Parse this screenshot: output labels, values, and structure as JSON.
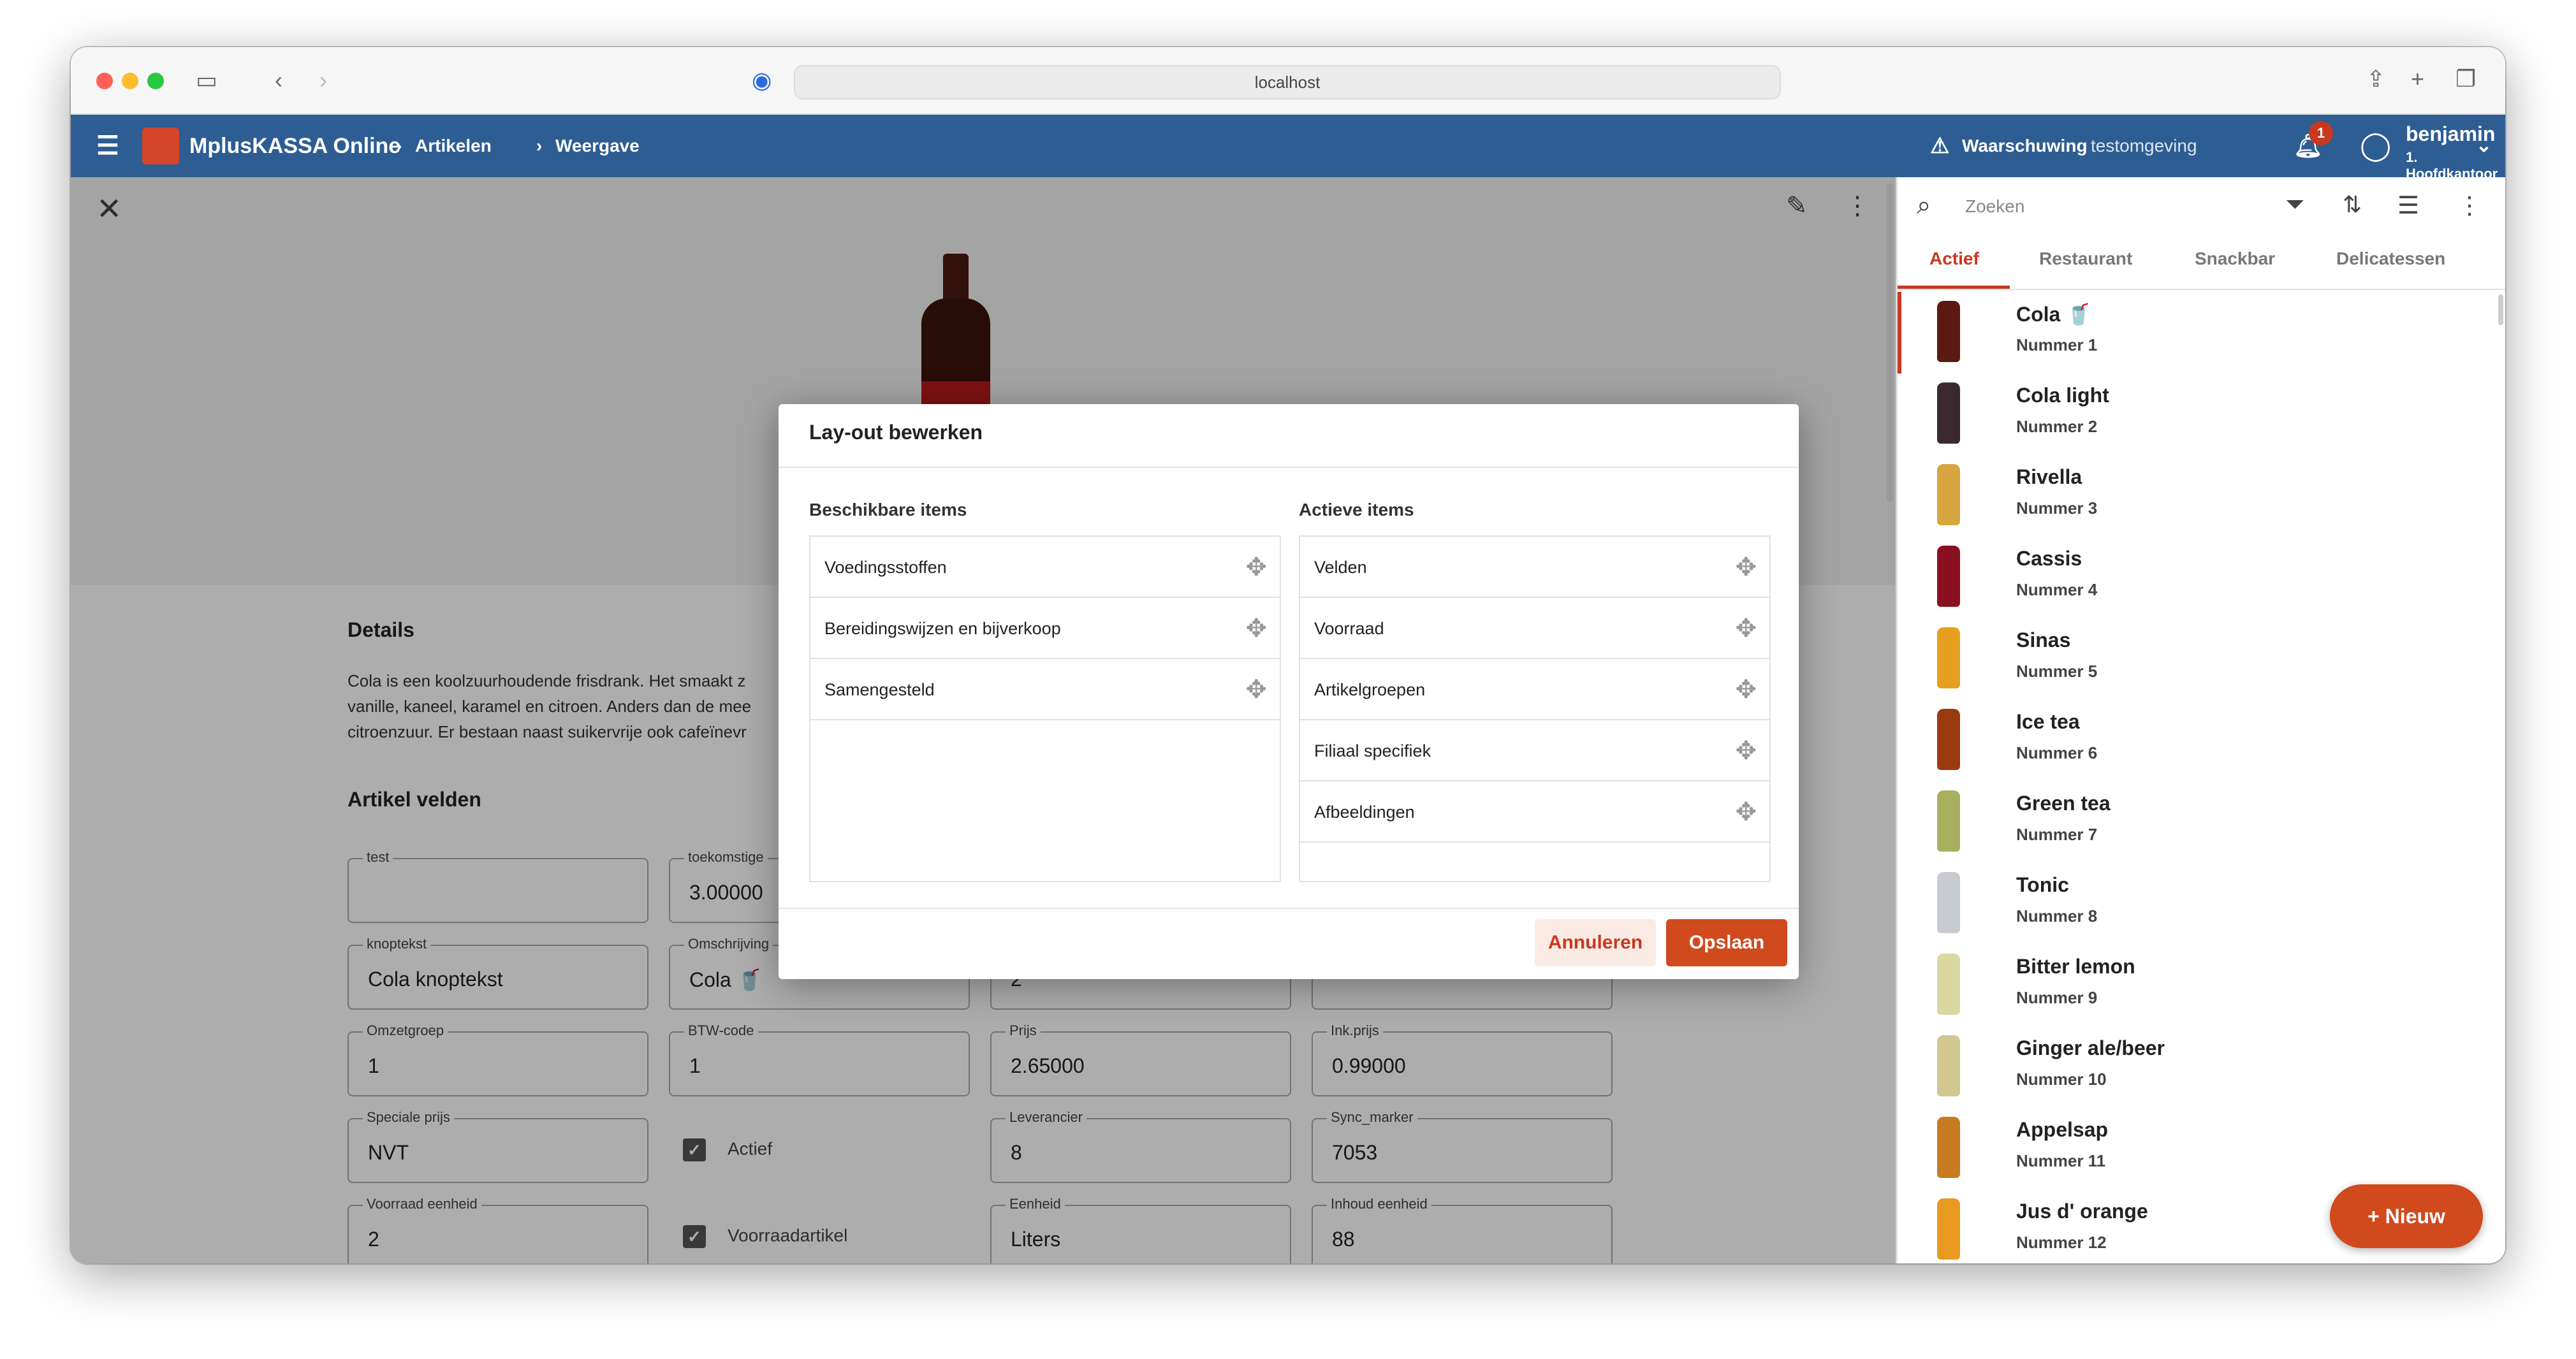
{
  "browser": {
    "url": "localhost"
  },
  "appbar": {
    "brand": "MplusKASSA Online",
    "crumb1": "Artikelen",
    "crumb2": "Weergave",
    "warning": "Waarschuwing",
    "warning_sub": "testomgeving",
    "notif_count": "1",
    "user_name": "benjamin",
    "user_branch": "1. Hoofdkantoor"
  },
  "main": {
    "details_title": "Details",
    "desc_l1": "Cola is een koolzuurhoudende frisdrank. Het smaakt z",
    "desc_l2": "vanille, kaneel, karamel en citroen. Anders dan de mee",
    "desc_l3": "citroenzuur. Er bestaan naast suikervrije ook cafeïnevr",
    "fields_title": "Artikel velden"
  },
  "fields": [
    {
      "label": "test",
      "value": ""
    },
    {
      "label": "toekomstige",
      "value": "3.00000"
    },
    {
      "label": "knoptekst",
      "value": "Cola knoptekst"
    },
    {
      "label": "Omschrijving",
      "value": "Cola 🥤"
    },
    {
      "label": "",
      "value": "2"
    },
    {
      "label": "",
      "value": ""
    },
    {
      "label": "Omzetgroep",
      "value": "1"
    },
    {
      "label": "BTW-code",
      "value": "1"
    },
    {
      "label": "Prijs",
      "value": "2.65000"
    },
    {
      "label": "Ink.prijs",
      "value": "0.99000"
    },
    {
      "label": "Speciale prijs",
      "value": "NVT"
    },
    {
      "label": "Leverancier",
      "value": "8"
    },
    {
      "label": "Sync_marker",
      "value": "7053"
    },
    {
      "label": "Voorraad eenheid",
      "value": "2"
    },
    {
      "label": "Eenheid",
      "value": "Liters"
    },
    {
      "label": "Inhoud eenheid",
      "value": "88"
    }
  ],
  "checks": {
    "actief": "Actief",
    "voorraad": "Voorraadartikel"
  },
  "modal": {
    "title": "Lay-out bewerken",
    "left_title": "Beschikbare items",
    "right_title": "Actieve items",
    "left": [
      "Voedingsstoffen",
      "Bereidingswijzen en bijverkoop",
      "Samengesteld"
    ],
    "right": [
      "Velden",
      "Voorraad",
      "Artikelgroepen",
      "Filiaal specifiek",
      "Afbeeldingen"
    ],
    "cancel": "Annuleren",
    "save": "Opslaan"
  },
  "sidebar": {
    "search_placeholder": "Zoeken",
    "tabs": [
      "Actief",
      "Restaurant",
      "Snackbar",
      "Delicatessen"
    ],
    "items": [
      {
        "name": "Cola 🥤",
        "nr": "Nummer 1",
        "color": "#5a1a12"
      },
      {
        "name": "Cola light",
        "nr": "Nummer 2",
        "color": "#3a2a30"
      },
      {
        "name": "Rivella",
        "nr": "Nummer 3",
        "color": "#d8a640"
      },
      {
        "name": "Cassis",
        "nr": "Nummer 4",
        "color": "#8a1020"
      },
      {
        "name": "Sinas",
        "nr": "Nummer 5",
        "color": "#e6a020"
      },
      {
        "name": "Ice tea",
        "nr": "Nummer 6",
        "color": "#9a3a10"
      },
      {
        "name": "Green tea",
        "nr": "Nummer 7",
        "color": "#a8b060"
      },
      {
        "name": "Tonic",
        "nr": "Nummer 8",
        "color": "#c8ccd0"
      },
      {
        "name": "Bitter lemon",
        "nr": "Nummer 9",
        "color": "#d8d8a0"
      },
      {
        "name": "Ginger ale/beer",
        "nr": "Nummer 10",
        "color": "#d0c890"
      },
      {
        "name": "Appelsap",
        "nr": "Nummer 11",
        "color": "#c87a20"
      },
      {
        "name": "Jus d' orange",
        "nr": "Nummer 12",
        "color": "#e89a20"
      }
    ],
    "new_button": "Nieuw"
  }
}
